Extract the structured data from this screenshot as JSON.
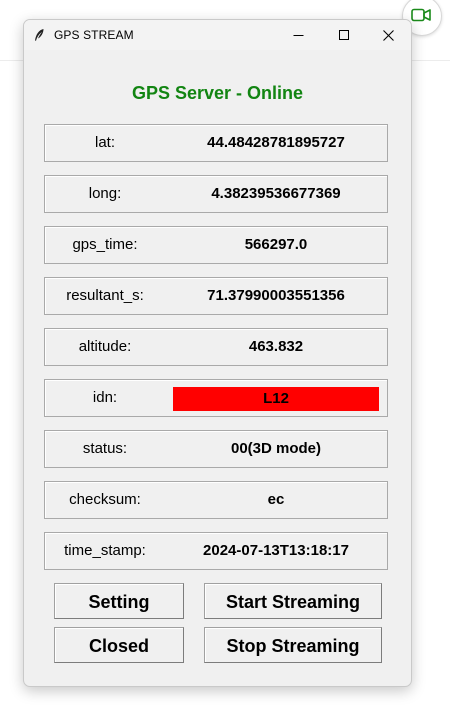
{
  "window": {
    "title": "GPS STREAM"
  },
  "heading": "GPS Server - Online",
  "colors": {
    "heading": "#128512",
    "idn_highlight": "#ff0000",
    "window_bg": "#f0f0f0",
    "camera_icon": "#1a8a1a"
  },
  "icons": {
    "app": "feather-icon",
    "minimize": "minimize-icon",
    "maximize": "maximize-icon",
    "close": "close-icon",
    "camera": "video-camera-icon"
  },
  "fields": [
    {
      "label": "lat:",
      "value": "44.48428781895727"
    },
    {
      "label": "long:",
      "value": "4.38239536677369"
    },
    {
      "label": "gps_time:",
      "value": "566297.0"
    },
    {
      "label": "resultant_s:",
      "value": "71.37990003551356"
    },
    {
      "label": "altitude:",
      "value": "463.832"
    },
    {
      "label": "idn:",
      "value": "L12"
    },
    {
      "label": "status:",
      "value": "00(3D mode)"
    },
    {
      "label": "checksum:",
      "value": "ec"
    },
    {
      "label": "time_stamp:",
      "value": "2024-07-13T13:18:17"
    }
  ],
  "buttons": {
    "setting": "Setting",
    "start_streaming": "Start Streaming",
    "closed": "Closed",
    "stop_streaming": "Stop Streaming"
  }
}
